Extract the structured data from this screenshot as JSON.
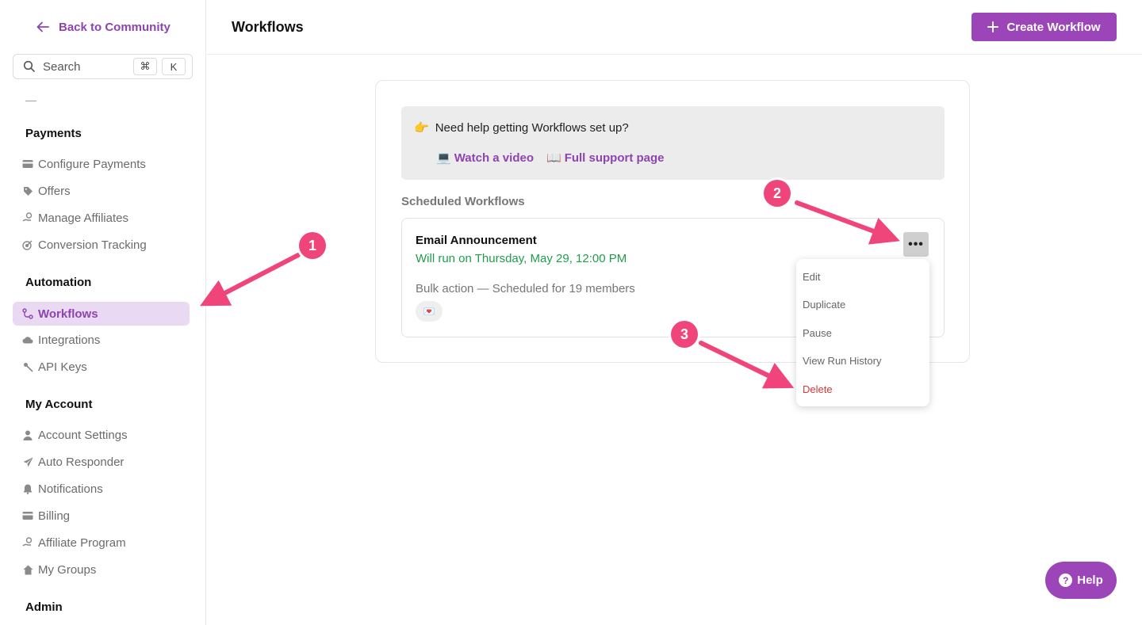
{
  "sidebar": {
    "back_label": "Back to Community",
    "search": {
      "label": "Search",
      "kbd_cmd": "⌘",
      "kbd_key": "K"
    },
    "dash": "—",
    "sections": {
      "payments": "Payments",
      "automation": "Automation",
      "my_account": "My Account",
      "admin": "Admin"
    },
    "items": {
      "configure_payments": "Configure Payments",
      "offers": "Offers",
      "manage_affiliates": "Manage Affiliates",
      "conversion_tracking": "Conversion Tracking",
      "workflows": "Workflows",
      "integrations": "Integrations",
      "api_keys": "API Keys",
      "account_settings": "Account Settings",
      "auto_responder": "Auto Responder",
      "notifications": "Notifications",
      "billing": "Billing",
      "affiliate_program": "Affiliate Program",
      "my_groups": "My Groups"
    }
  },
  "header": {
    "title": "Workflows",
    "create_label": "Create Workflow"
  },
  "help_box": {
    "emoji": "👉",
    "question": "Need help getting Workflows set up?",
    "video_emoji": "💻",
    "video_label": "Watch a video",
    "support_emoji": "📖",
    "support_label": "Full support page"
  },
  "scheduled": {
    "label": "Scheduled Workflows",
    "item": {
      "name": "Email Announcement",
      "run_text": "Will run on Thursday, May 29, 12:00 PM",
      "bulk_text": "Bulk action — Scheduled for 19 members",
      "chip_emoji": "💌",
      "more_label": "•••"
    }
  },
  "menu": {
    "edit": "Edit",
    "duplicate": "Duplicate",
    "pause": "Pause",
    "view_run_history": "View Run History",
    "delete": "Delete"
  },
  "markers": {
    "one": "1",
    "two": "2",
    "three": "3"
  },
  "help_bubble": {
    "icon": "?",
    "label": "Help"
  },
  "colors": {
    "accent": "#9b45b8",
    "accent_text": "#8e44ad",
    "success": "#1e9e4a",
    "danger": "#d93636",
    "marker": "#f0457a"
  }
}
